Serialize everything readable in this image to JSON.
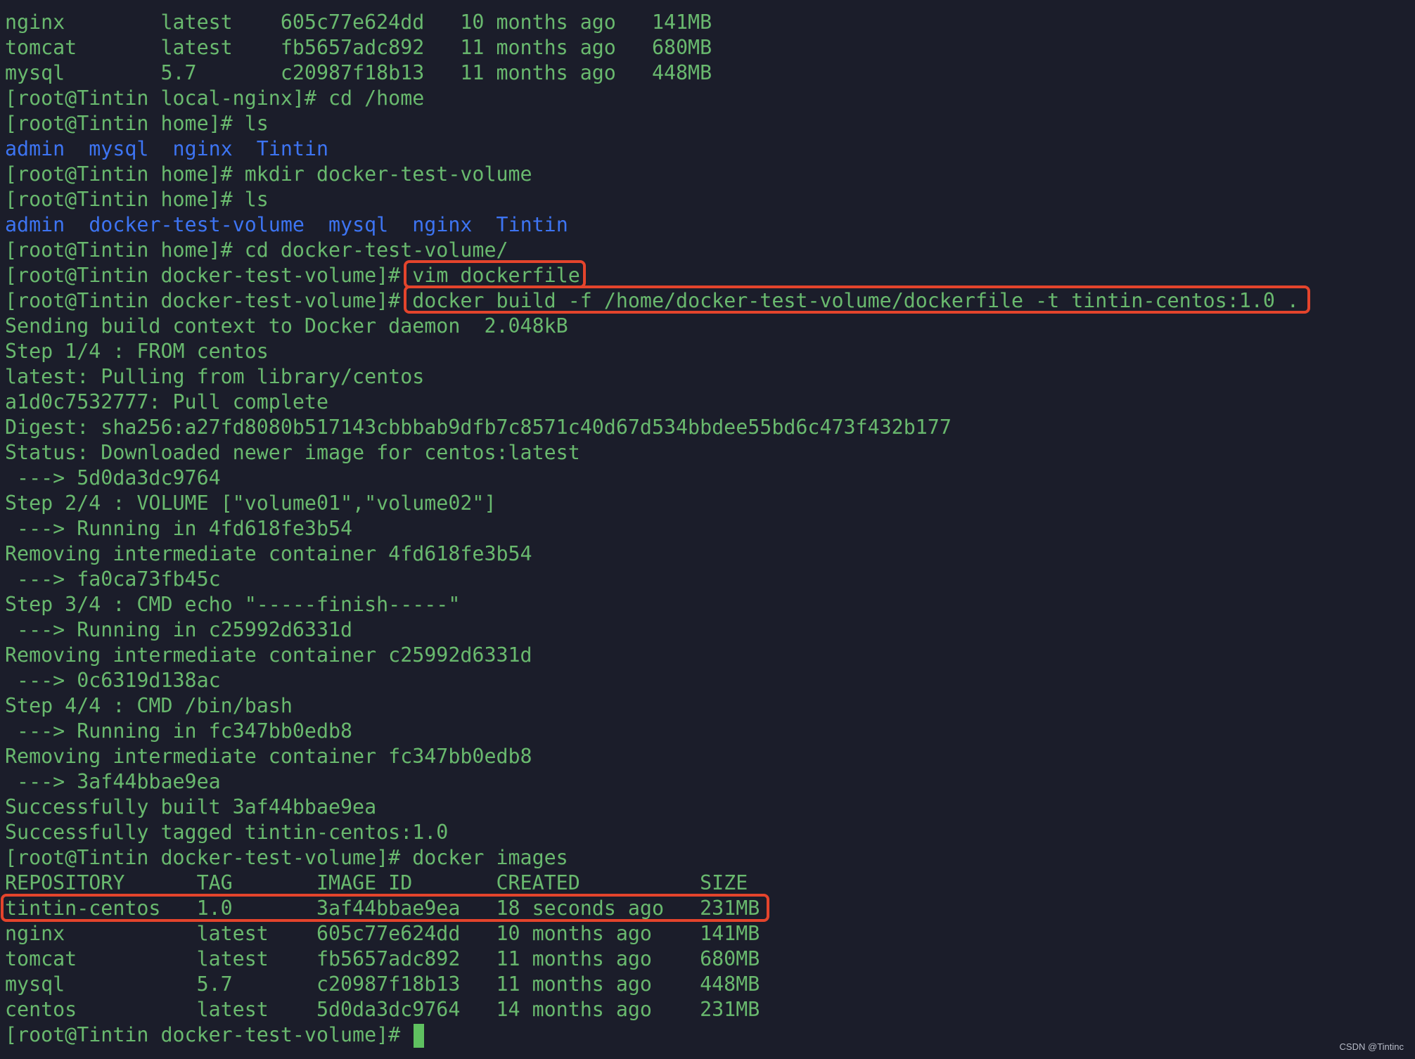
{
  "theme": {
    "background": "#1b1d2a",
    "text_color": "#69b96e",
    "directory_color": "#3d74f2",
    "highlight_color": "#e4442c",
    "cursor_color": "#5fc160"
  },
  "terminal": {
    "lines": [
      "nginx        latest    605c77e624dd   10 months ago   141MB",
      "tomcat       latest    fb5657adc892   11 months ago   680MB",
      "mysql        5.7       c20987f18b13   11 months ago   448MB",
      "[root@Tintin local-nginx]# cd /home",
      "[root@Tintin home]# ls",
      "__DIRS1__",
      "[root@Tintin home]# mkdir docker-test-volume",
      "[root@Tintin home]# ls",
      "__DIRS2__",
      "[root@Tintin home]# cd docker-test-volume/",
      "__CMD_VIM__",
      "__CMD_BUILD__",
      "Sending build context to Docker daemon  2.048kB",
      "Step 1/4 : FROM centos",
      "latest: Pulling from library/centos",
      "a1d0c7532777: Pull complete",
      "Digest: sha256:a27fd8080b517143cbbbab9dfb7c8571c40d67d534bbdee55bd6c473f432b177",
      "Status: Downloaded newer image for centos:latest",
      " ---> 5d0da3dc9764",
      "Step 2/4 : VOLUME [\"volume01\",\"volume02\"]",
      " ---> Running in 4fd618fe3b54",
      "Removing intermediate container 4fd618fe3b54",
      " ---> fa0ca73fb45c",
      "Step 3/4 : CMD echo \"-----finish-----\"",
      " ---> Running in c25992d6331d",
      "Removing intermediate container c25992d6331d",
      " ---> 0c6319d138ac",
      "Step 4/4 : CMD /bin/bash",
      " ---> Running in fc347bb0edb8",
      "Removing intermediate container fc347bb0edb8",
      " ---> 3af44bbae9ea",
      "Successfully built 3af44bbae9ea",
      "Successfully tagged tintin-centos:1.0",
      "[root@Tintin docker-test-volume]# docker images",
      "REPOSITORY      TAG       IMAGE ID       CREATED          SIZE",
      "__HL_ROW__",
      "nginx           latest    605c77e624dd   10 months ago    141MB",
      "tomcat          latest    fb5657adc892   11 months ago    680MB",
      "mysql           5.7       c20987f18b13   11 months ago    448MB",
      "centos          latest    5d0da3dc9764   14 months ago    231MB",
      "__PROMPT_LAST__"
    ],
    "dirs1": [
      "admin",
      "mysql",
      "nginx",
      "Tintin"
    ],
    "dirs2": [
      "admin",
      "docker-test-volume",
      "mysql",
      "nginx",
      "Tintin"
    ],
    "vim_prompt": "[root@Tintin docker-test-volume]#",
    "vim_cmd": "vim dockerfile",
    "build_prompt": "[root@Tintin docker-test-volume]#",
    "build_cmd": "docker build -f /home/docker-test-volume/dockerfile -t tintin-centos:1.0 .",
    "highlighted_row": "tintin-centos   1.0       3af44bbae9ea   18 seconds ago   231MB",
    "last_prompt": "[root@Tintin docker-test-volume]#"
  },
  "watermark": "CSDN @Tintinc"
}
